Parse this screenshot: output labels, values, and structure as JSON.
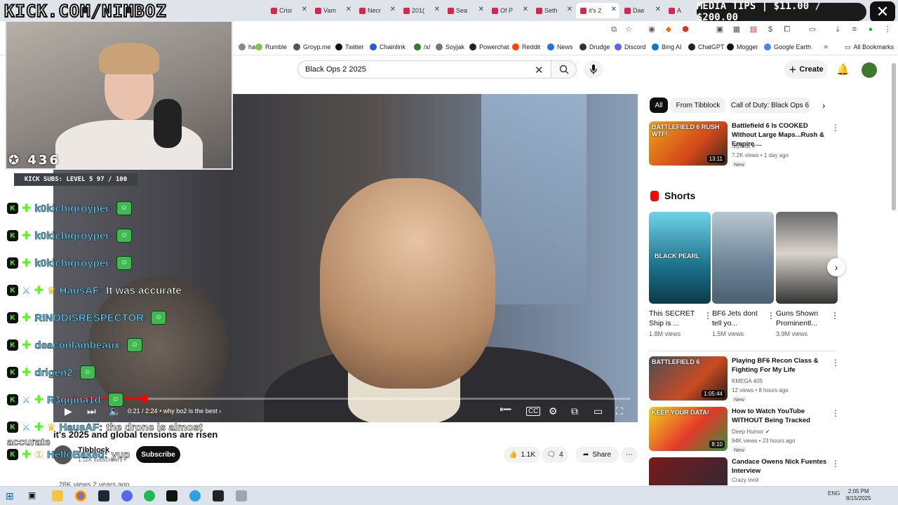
{
  "browser": {
    "tabs": [
      {
        "label": "Crisi",
        "active": false
      },
      {
        "label": "Vam",
        "active": false
      },
      {
        "label": "Necr",
        "active": false
      },
      {
        "label": "201(",
        "active": false
      },
      {
        "label": "Sea",
        "active": false
      },
      {
        "label": "Of P",
        "active": false
      },
      {
        "label": "Seth",
        "active": false
      },
      {
        "label": "it's 2",
        "active": true
      },
      {
        "label": "Dae",
        "active": false
      },
      {
        "label": "A",
        "active": false
      }
    ],
    "bookmarks": [
      {
        "label": "hat",
        "color": "#888888"
      },
      {
        "label": "Rumble",
        "color": "#85c742"
      },
      {
        "label": "Groyp.me",
        "color": "#555555"
      },
      {
        "label": "Twitter",
        "color": "#111111"
      },
      {
        "label": "Chainlink",
        "color": "#2a5ada"
      },
      {
        "label": "/x/",
        "color": "#2e7d32"
      },
      {
        "label": "Soyjak",
        "color": "#777777"
      },
      {
        "label": "Powerchat",
        "color": "#222222"
      },
      {
        "label": "Reddit",
        "color": "#ff4500"
      },
      {
        "label": "News",
        "color": "#1a73e8"
      },
      {
        "label": "Drudge",
        "color": "#333333"
      },
      {
        "label": "Discord",
        "color": "#5865f2"
      },
      {
        "label": "Bing AI",
        "color": "#0078d4"
      },
      {
        "label": "ChatGPT",
        "color": "#222222"
      },
      {
        "label": "Mogger",
        "color": "#111111"
      },
      {
        "label": "Google Earth",
        "color": "#4285f4"
      }
    ],
    "all_bookmarks": "All Bookmarks"
  },
  "overlay": {
    "watermark": "KICK.COM/NIMBOZ",
    "media_tips": "MEDIA TIPS | $11.00 / $200.00",
    "viewer_count": "436",
    "kick_subs": "KICK SUBS: LEVEL 5 97 / 100",
    "chat": [
      {
        "user": "k0kichigroyper:",
        "color": "#5fd3ff",
        "badges": [
          "k",
          "boost"
        ],
        "message": "",
        "emote": true
      },
      {
        "user": "k0kichigroyper:",
        "color": "#5fd3ff",
        "badges": [
          "k",
          "boost"
        ],
        "message": "",
        "emote": true
      },
      {
        "user": "k0kichigroyper:",
        "color": "#5fd3ff",
        "badges": [
          "k",
          "boost"
        ],
        "message": "",
        "emote": true
      },
      {
        "user": "HausAF:",
        "color": "#5fd3ff",
        "badges": [
          "k",
          "sword",
          "boost",
          "crown"
        ],
        "message": "It was accurate",
        "emote": false
      },
      {
        "user": "RINODISRESPECTOR:",
        "color": "#5fd3ff",
        "badges": [
          "k",
          "boost"
        ],
        "message": "",
        "emote": true
      },
      {
        "user": "deaconlambeaux:",
        "color": "#5fd3ff",
        "badges": [
          "k",
          "boost"
        ],
        "message": "",
        "emote": true
      },
      {
        "user": "drigen2:",
        "color": "#5fd3ff",
        "badges": [
          "k",
          "boost"
        ],
        "message": "",
        "emote": true
      },
      {
        "user": "R3ggina1d:",
        "color": "#5fd3ff",
        "badges": [
          "k",
          "sword",
          "boost"
        ],
        "message": "",
        "emote": true
      },
      {
        "user": "HausAF:",
        "color": "#5fd3ff",
        "badges": [
          "k",
          "sword",
          "boost",
          "crown"
        ],
        "message": "the drone is almost",
        "emote": false
      },
      {
        "user": "HelloBaked:",
        "color": "#5fd3ff",
        "badges": [
          "k",
          "boost",
          "one"
        ],
        "message": "yup",
        "emote": false
      }
    ],
    "chat_wrap": "accurate"
  },
  "youtube": {
    "search_value": "Black Ops 2 2025",
    "create_label": "Create",
    "video": {
      "time": "0:21 / 2:24",
      "chapter": "why bo2 is the best",
      "progress": 0.146,
      "title": "it's 2025 and global tensions are risen",
      "channel": "Tibblock",
      "subscribers": "1.11K subscribers",
      "subscribe_label": "Subscribe",
      "likes": "1.1K",
      "comments": "4",
      "share_label": "Share",
      "views": "28K views  2 years ago"
    },
    "chips": [
      {
        "label": "All",
        "active": true
      },
      {
        "label": "From Tibblock",
        "active": false
      },
      {
        "label": "Call of Duty: Black Ops 6",
        "active": false
      }
    ],
    "shorts_label": "Shorts",
    "recommendations": [
      {
        "title": "Battlefield 6 Is COOKED Without Large Maps...Rush & Empire ...",
        "channel": "Stylosa",
        "verified": true,
        "meta": "7.2K views • 1 day ago",
        "badge": "New",
        "duration": "13:11",
        "thumb_text": "BATTLEFIELD 6 RUSH WTF!"
      },
      {
        "title": "Playing BF6 Recon Class & Fighting For My Life",
        "channel": "KMEGA 405",
        "verified": false,
        "meta": "12 views • 8 hours ago",
        "badge": "New",
        "duration": "1:05:44",
        "thumb_text": "BATTLEFIELD 6"
      },
      {
        "title": "How to Watch YouTube WITHOUT Being Tracked",
        "channel": "Deep Humor",
        "verified": true,
        "meta": "94K views • 23 hours ago",
        "badge": "New",
        "duration": "8:10",
        "thumb_text": "KEEP YOUR DATA!"
      },
      {
        "title": "Candace Owens Nick Fuentes Interview",
        "channel": "Crazy Innit",
        "verified": false,
        "meta": "",
        "badge": "",
        "duration": "",
        "thumb_text": ""
      }
    ],
    "shorts": [
      {
        "title": "This SECRET Ship is ...",
        "views": "1.8M views",
        "thumb_text": "BLACK PEARL"
      },
      {
        "title": "BF6 Jets dont tell yo...",
        "views": "1.5M views",
        "thumb_text": ""
      },
      {
        "title": "Guns Shown Prominentl...",
        "views": "3.9M views",
        "thumb_text": ""
      }
    ]
  },
  "taskbar": {
    "lang": "ENG",
    "time": "2:05 PM",
    "date": "8/15/2025"
  }
}
